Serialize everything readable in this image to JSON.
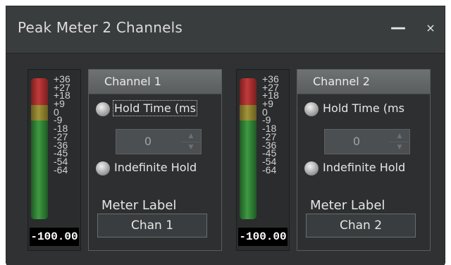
{
  "window": {
    "title": "Peak Meter 2 Channels",
    "minimize_glyph": "—",
    "close_glyph": "×"
  },
  "meter_scale": [
    "+36",
    "+27",
    "+18",
    "+9",
    "0",
    "-9",
    "-18",
    "-27",
    "-36",
    "-45",
    "-54",
    "-64"
  ],
  "channels": [
    {
      "title": "Channel 1",
      "peak_value": "-100.00",
      "hold_time_label": "Hold Time (ms",
      "hold_time_value": "0",
      "indefinite_hold_label": "Indefinite Hold",
      "meter_label_caption": "Meter Label",
      "meter_label_value": "Chan 1"
    },
    {
      "title": "Channel 2",
      "peak_value": "-100.00",
      "hold_time_label": "Hold Time (ms",
      "hold_time_value": "0",
      "indefinite_hold_label": "Indefinite Hold",
      "meter_label_caption": "Meter Label",
      "meter_label_value": "Chan 2"
    }
  ],
  "colors": {
    "window_bg": "#3a3d3e",
    "content_bg": "#2f3132",
    "meter_red": "#c23a3a",
    "meter_yellow": "#a0953a",
    "meter_green": "#3f9a42"
  }
}
